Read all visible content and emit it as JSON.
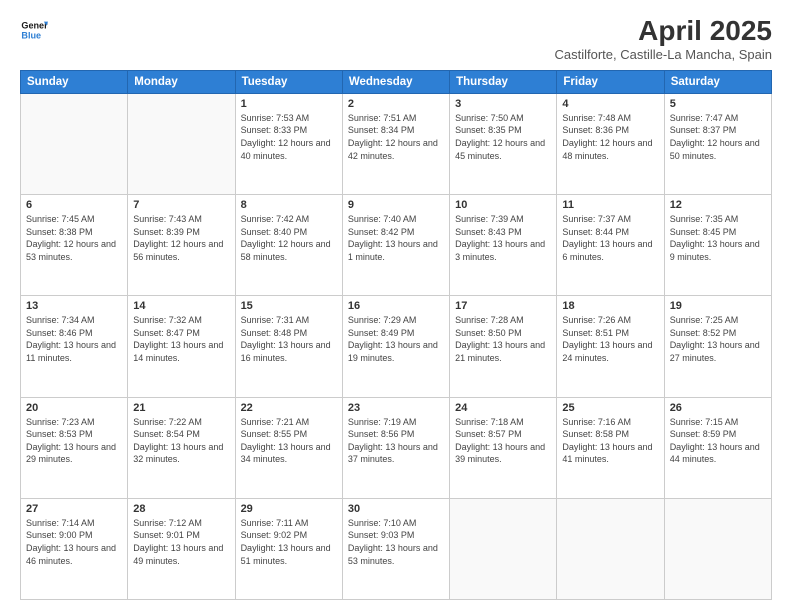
{
  "logo": {
    "line1": "General",
    "line2": "Blue"
  },
  "title": "April 2025",
  "location": "Castilforte, Castille-La Mancha, Spain",
  "headers": [
    "Sunday",
    "Monday",
    "Tuesday",
    "Wednesday",
    "Thursday",
    "Friday",
    "Saturday"
  ],
  "weeks": [
    [
      {
        "day": "",
        "info": ""
      },
      {
        "day": "",
        "info": ""
      },
      {
        "day": "1",
        "info": "Sunrise: 7:53 AM\nSunset: 8:33 PM\nDaylight: 12 hours and 40 minutes."
      },
      {
        "day": "2",
        "info": "Sunrise: 7:51 AM\nSunset: 8:34 PM\nDaylight: 12 hours and 42 minutes."
      },
      {
        "day": "3",
        "info": "Sunrise: 7:50 AM\nSunset: 8:35 PM\nDaylight: 12 hours and 45 minutes."
      },
      {
        "day": "4",
        "info": "Sunrise: 7:48 AM\nSunset: 8:36 PM\nDaylight: 12 hours and 48 minutes."
      },
      {
        "day": "5",
        "info": "Sunrise: 7:47 AM\nSunset: 8:37 PM\nDaylight: 12 hours and 50 minutes."
      }
    ],
    [
      {
        "day": "6",
        "info": "Sunrise: 7:45 AM\nSunset: 8:38 PM\nDaylight: 12 hours and 53 minutes."
      },
      {
        "day": "7",
        "info": "Sunrise: 7:43 AM\nSunset: 8:39 PM\nDaylight: 12 hours and 56 minutes."
      },
      {
        "day": "8",
        "info": "Sunrise: 7:42 AM\nSunset: 8:40 PM\nDaylight: 12 hours and 58 minutes."
      },
      {
        "day": "9",
        "info": "Sunrise: 7:40 AM\nSunset: 8:42 PM\nDaylight: 13 hours and 1 minute."
      },
      {
        "day": "10",
        "info": "Sunrise: 7:39 AM\nSunset: 8:43 PM\nDaylight: 13 hours and 3 minutes."
      },
      {
        "day": "11",
        "info": "Sunrise: 7:37 AM\nSunset: 8:44 PM\nDaylight: 13 hours and 6 minutes."
      },
      {
        "day": "12",
        "info": "Sunrise: 7:35 AM\nSunset: 8:45 PM\nDaylight: 13 hours and 9 minutes."
      }
    ],
    [
      {
        "day": "13",
        "info": "Sunrise: 7:34 AM\nSunset: 8:46 PM\nDaylight: 13 hours and 11 minutes."
      },
      {
        "day": "14",
        "info": "Sunrise: 7:32 AM\nSunset: 8:47 PM\nDaylight: 13 hours and 14 minutes."
      },
      {
        "day": "15",
        "info": "Sunrise: 7:31 AM\nSunset: 8:48 PM\nDaylight: 13 hours and 16 minutes."
      },
      {
        "day": "16",
        "info": "Sunrise: 7:29 AM\nSunset: 8:49 PM\nDaylight: 13 hours and 19 minutes."
      },
      {
        "day": "17",
        "info": "Sunrise: 7:28 AM\nSunset: 8:50 PM\nDaylight: 13 hours and 21 minutes."
      },
      {
        "day": "18",
        "info": "Sunrise: 7:26 AM\nSunset: 8:51 PM\nDaylight: 13 hours and 24 minutes."
      },
      {
        "day": "19",
        "info": "Sunrise: 7:25 AM\nSunset: 8:52 PM\nDaylight: 13 hours and 27 minutes."
      }
    ],
    [
      {
        "day": "20",
        "info": "Sunrise: 7:23 AM\nSunset: 8:53 PM\nDaylight: 13 hours and 29 minutes."
      },
      {
        "day": "21",
        "info": "Sunrise: 7:22 AM\nSunset: 8:54 PM\nDaylight: 13 hours and 32 minutes."
      },
      {
        "day": "22",
        "info": "Sunrise: 7:21 AM\nSunset: 8:55 PM\nDaylight: 13 hours and 34 minutes."
      },
      {
        "day": "23",
        "info": "Sunrise: 7:19 AM\nSunset: 8:56 PM\nDaylight: 13 hours and 37 minutes."
      },
      {
        "day": "24",
        "info": "Sunrise: 7:18 AM\nSunset: 8:57 PM\nDaylight: 13 hours and 39 minutes."
      },
      {
        "day": "25",
        "info": "Sunrise: 7:16 AM\nSunset: 8:58 PM\nDaylight: 13 hours and 41 minutes."
      },
      {
        "day": "26",
        "info": "Sunrise: 7:15 AM\nSunset: 8:59 PM\nDaylight: 13 hours and 44 minutes."
      }
    ],
    [
      {
        "day": "27",
        "info": "Sunrise: 7:14 AM\nSunset: 9:00 PM\nDaylight: 13 hours and 46 minutes."
      },
      {
        "day": "28",
        "info": "Sunrise: 7:12 AM\nSunset: 9:01 PM\nDaylight: 13 hours and 49 minutes."
      },
      {
        "day": "29",
        "info": "Sunrise: 7:11 AM\nSunset: 9:02 PM\nDaylight: 13 hours and 51 minutes."
      },
      {
        "day": "30",
        "info": "Sunrise: 7:10 AM\nSunset: 9:03 PM\nDaylight: 13 hours and 53 minutes."
      },
      {
        "day": "",
        "info": ""
      },
      {
        "day": "",
        "info": ""
      },
      {
        "day": "",
        "info": ""
      }
    ]
  ]
}
